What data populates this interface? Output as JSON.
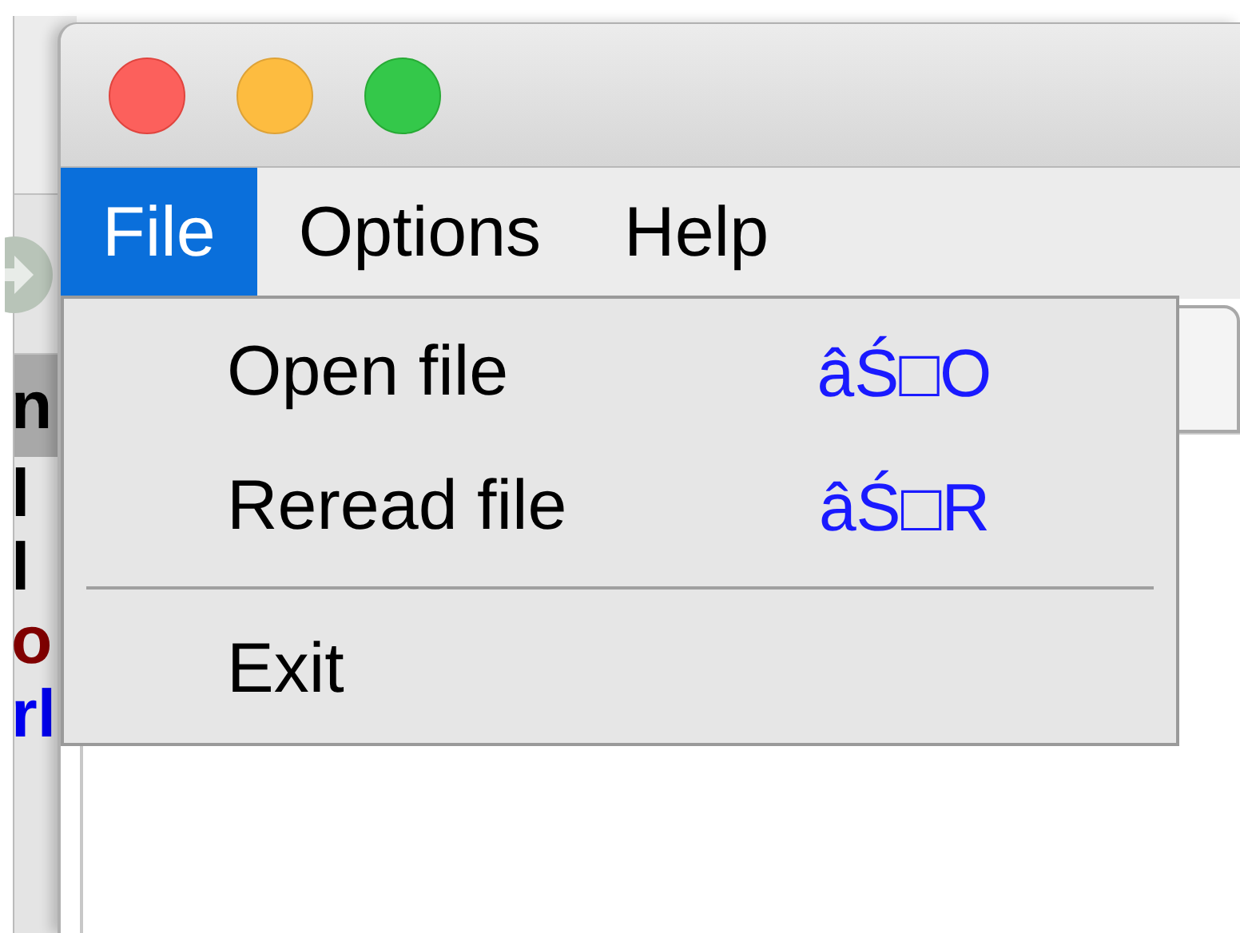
{
  "background_window": {
    "rows": [
      {
        "text": "n",
        "kind": "header",
        "color": "#000000"
      },
      {
        "text": "l",
        "kind": "row",
        "color": "#000000"
      },
      {
        "text": "l",
        "kind": "row",
        "color": "#000000"
      },
      {
        "text": "o",
        "kind": "row",
        "color": "#800000"
      },
      {
        "text": "rl",
        "kind": "row",
        "color": "#0000ee"
      }
    ]
  },
  "menubar": [
    {
      "label": "File",
      "selected": true
    },
    {
      "label": "Options",
      "selected": false
    },
    {
      "label": "Help",
      "selected": false
    }
  ],
  "menu": [
    {
      "kind": "item",
      "label": "Open file",
      "shortcut": "âŚ□O"
    },
    {
      "kind": "item",
      "label": "Reread file",
      "shortcut": "âŚ□R"
    },
    {
      "kind": "separator"
    },
    {
      "kind": "item",
      "label": "Exit"
    }
  ]
}
